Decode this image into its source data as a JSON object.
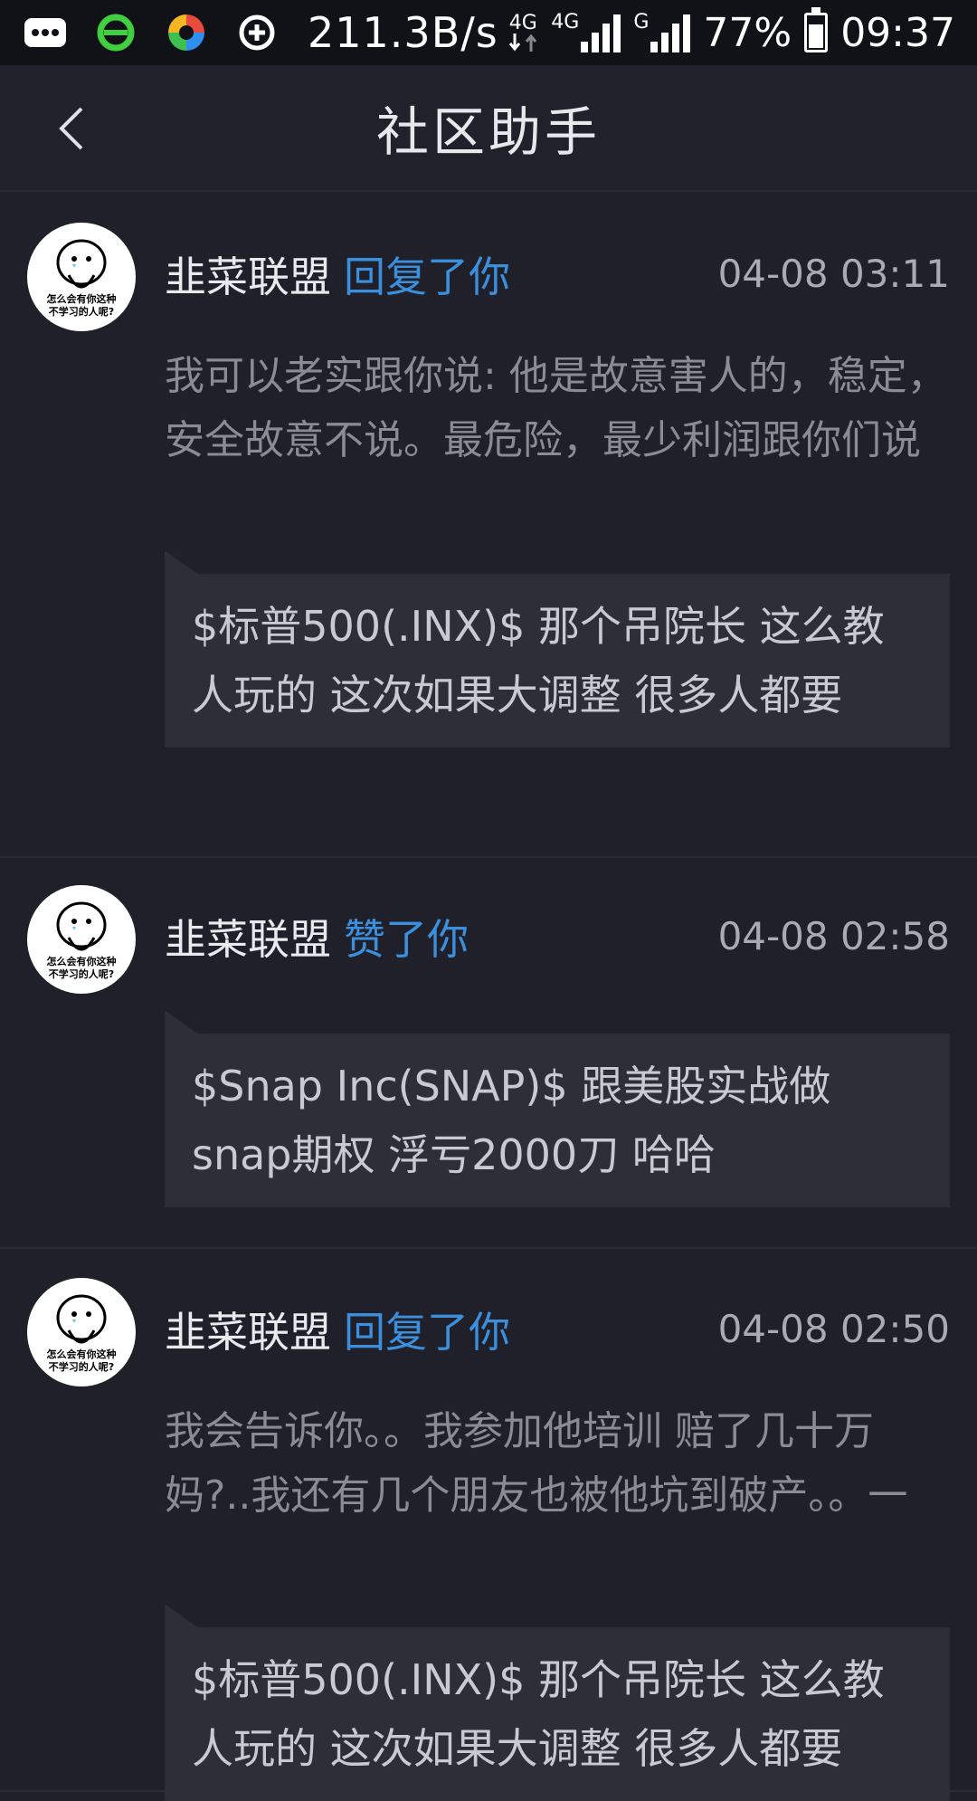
{
  "status_bar": {
    "speed": "211.3B/s",
    "net1": "4G",
    "net2": "4G",
    "net3": "G",
    "battery": "77%",
    "time": "09:37",
    "icons": [
      "message-icon",
      "browser-icon",
      "app-icon",
      "vpn-icon",
      "data-arrows-icon",
      "signal-icon",
      "signal-icon",
      "battery-icon"
    ]
  },
  "header": {
    "title": "社区助手",
    "back_icon": "chevron-left-icon"
  },
  "notifications": [
    {
      "user": "韭菜联盟",
      "action": "回复了你",
      "time": "04-08 03:11",
      "avatar_caption": "怎么会有你这种\n不学习的人呢?",
      "comment": "我可以老实跟你说: 他是故意害人的，稳定，安全故意不说。最危险，最少利润跟你们说",
      "quote": "$标普500(.INX)$ 那个吊院长 这么教人玩的 这次如果大调整 很多人都要"
    },
    {
      "user": "韭菜联盟",
      "action": "赞了你",
      "time": "04-08 02:58",
      "avatar_caption": "怎么会有你这种\n不学习的人呢?",
      "comment": "",
      "quote": "$Snap Inc(SNAP)$ 跟美股实战做snap期权 浮亏2000刀 哈哈"
    },
    {
      "user": "韭菜联盟",
      "action": "回复了你",
      "time": "04-08 02:50",
      "avatar_caption": "怎么会有你这种\n不学习的人呢?",
      "comment": "我会告诉你。。我参加他培训 赔了几十万妈?..我还有几个朋友也被他坑到破产。。一",
      "quote": "$标普500(.INX)$ 那个吊院长 这么教人玩的 这次如果大调整 很多人都要"
    }
  ],
  "colors": {
    "background": "#1f2029",
    "action_link": "#3b8fdc",
    "quote_bg": "#2d2e38"
  }
}
